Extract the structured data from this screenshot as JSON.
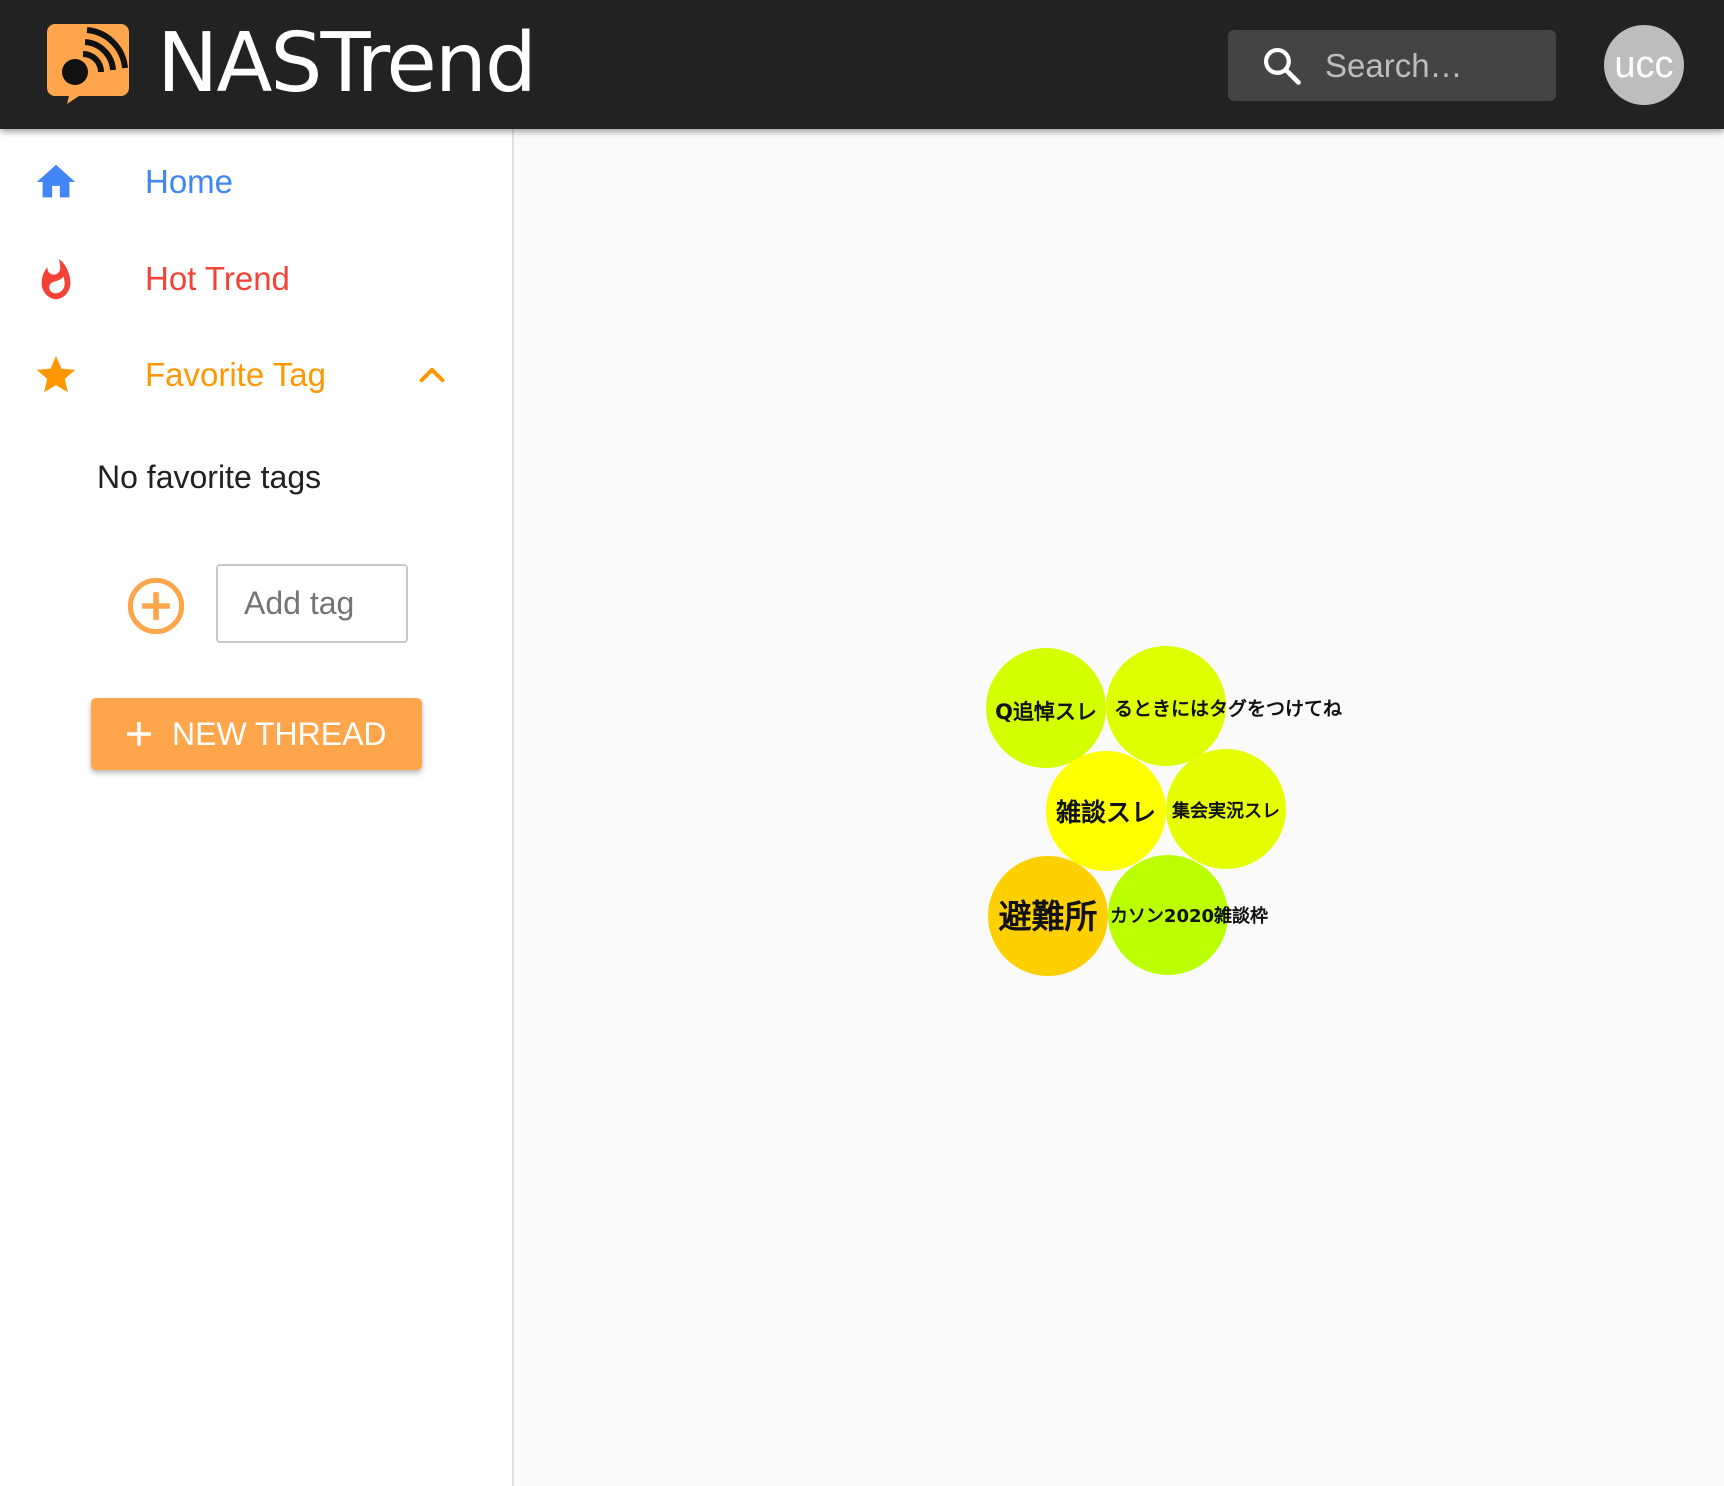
{
  "app": {
    "title": "NASTrend"
  },
  "header": {
    "search": {
      "placeholder": "Search…",
      "icon": "search-icon"
    },
    "avatar": "ucc"
  },
  "sidebar": {
    "items": [
      {
        "label": "Home",
        "icon": "home-icon",
        "color": "#4285f4"
      },
      {
        "label": "Hot Trend",
        "icon": "fire-icon",
        "color": "#f44336"
      },
      {
        "label": "Favorite Tag",
        "icon": "star-icon",
        "color": "#ff9800"
      }
    ],
    "favorites_empty": "No favorite tags",
    "add_tag_placeholder": "Add tag",
    "new_thread_label": "NEW THREAD"
  },
  "colors": {
    "accent": "#ffa64d",
    "appbar": "#222222"
  },
  "bubbles": [
    {
      "label": "Q追悼スレ",
      "color": "#d4ff00"
    },
    {
      "label": "るときにはタグをつけてね",
      "color": "#ddff00"
    },
    {
      "label": "雑談スレ",
      "color": "#ffff00"
    },
    {
      "label": "集会実況スレ",
      "color": "#e6ff00"
    },
    {
      "label": "避難所",
      "color": "#ffd000"
    },
    {
      "label": "カソン2020雑談枠",
      "color": "#bbff00"
    }
  ]
}
